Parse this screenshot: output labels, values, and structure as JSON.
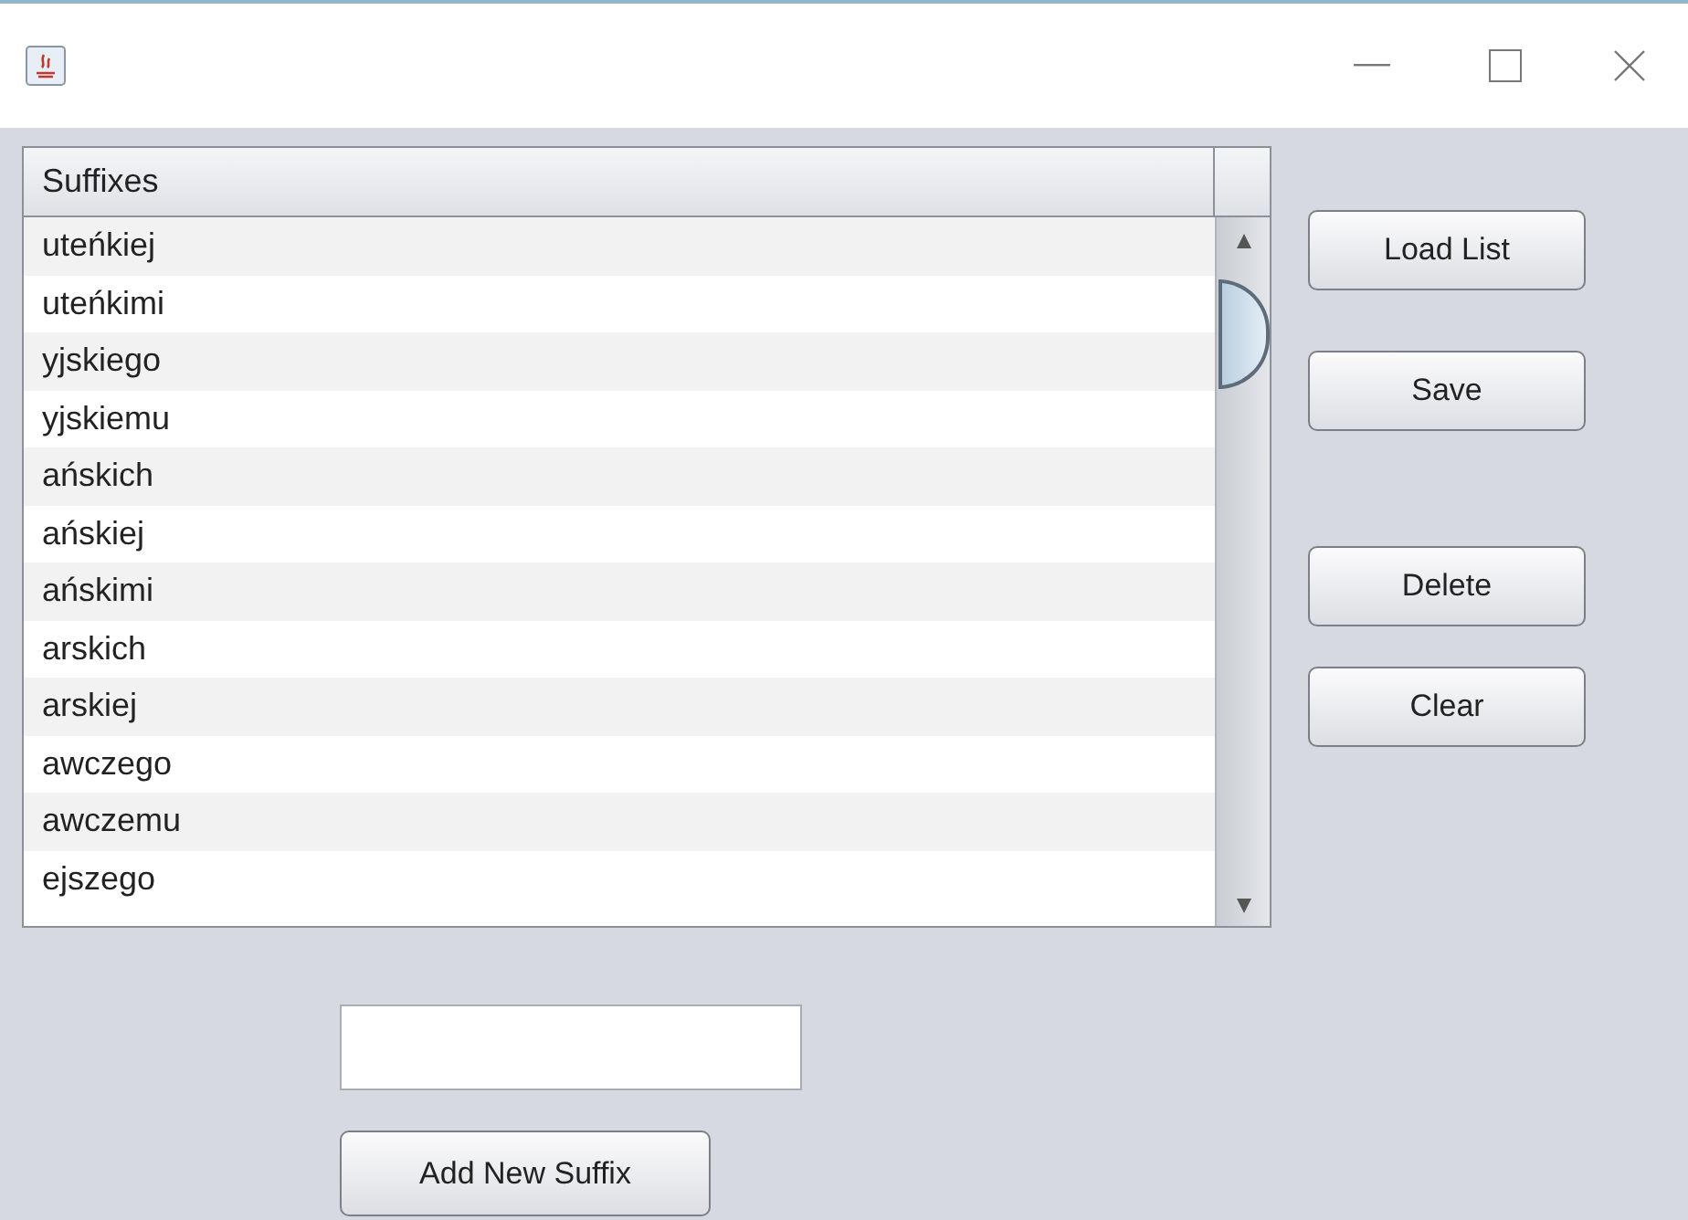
{
  "table": {
    "columns": [
      "Suffixes"
    ],
    "rows": [
      "uteńkiej",
      "uteńkimi",
      "yjskiego",
      "yjskiemu",
      "ańskich",
      "ańskiej",
      "ańskimi",
      "arskich",
      "arskiej",
      "awczego",
      "awczemu",
      "ejszego"
    ]
  },
  "side_buttons": [
    "Load List",
    "Save",
    "Delete",
    "Clear"
  ],
  "add_button": "Add New Suffix"
}
